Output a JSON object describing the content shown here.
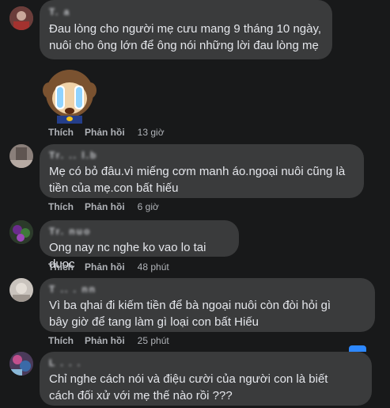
{
  "comments": [
    {
      "name": "T. a",
      "text": "Đau lòng cho người mẹ cưu mang 9 tháng 10 ngày,\nnuôi cho ông lớn để ông nói những lời đau lòng mẹ",
      "like": "Thích",
      "reply": "Phản hồi",
      "time": "13 giờ",
      "has_sticker": true,
      "sticker_icon": "crying-monkey-sticker"
    },
    {
      "name": "Tr.  .. l.b",
      "text": "Mẹ có bỏ đâu.vì miếng cơm manh áo.ngoại nuôi cũng là\ntiền của mẹ.con bất hiếu",
      "like": "Thích",
      "reply": "Phản hồi",
      "time": "6 giờ"
    },
    {
      "name": "Tr.  nuo",
      "text": "Ong nay nc nghe ko vao lo tai duoc",
      "like": "Thích",
      "reply": "Phản hồi",
      "time": "48 phút"
    },
    {
      "name": "T .. . nn",
      "text": "Vì ba qhai đi kiếm tiền để bà ngoại nuôi còn đòi hỏi gì\nbây giờ để tang làm gì loại con bất Hiếu",
      "like": "Thích",
      "reply": "Phản hồi",
      "time": "25 phút"
    },
    {
      "name": "L  . .  .",
      "text": "Chỉ nghe cách nói và điệu cười của người con là biết\ncách đối xử với mẹ thế nào rồi ???",
      "like": "Thích",
      "reply": "Phản hồi",
      "time": ""
    }
  ],
  "colors": {
    "background": "#18191a",
    "bubble": "#3a3b3c",
    "text": "#e4e6eb",
    "secondary": "#b0b3b8"
  }
}
